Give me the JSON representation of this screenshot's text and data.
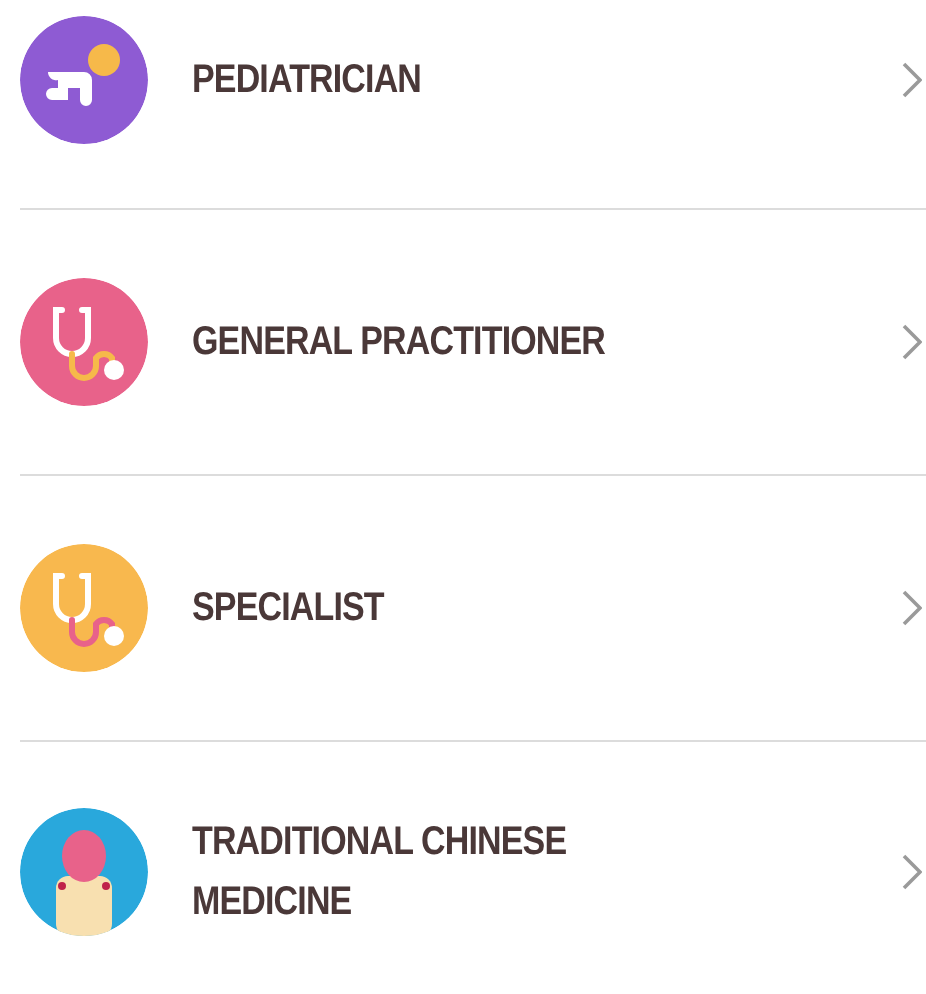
{
  "items": [
    {
      "label": "PEDIATRICIAN",
      "kind": "baby",
      "color": "#8e5bd3"
    },
    {
      "label": "GENERAL PRACTITIONER",
      "kind": "stethoscope",
      "color": "#e8628a"
    },
    {
      "label": "SPECIALIST",
      "kind": "stethoscope",
      "color": "#f8b84e"
    },
    {
      "label": "TRADITIONAL CHINESE MEDICINE",
      "kind": "body",
      "color": "#29a8dc"
    }
  ]
}
